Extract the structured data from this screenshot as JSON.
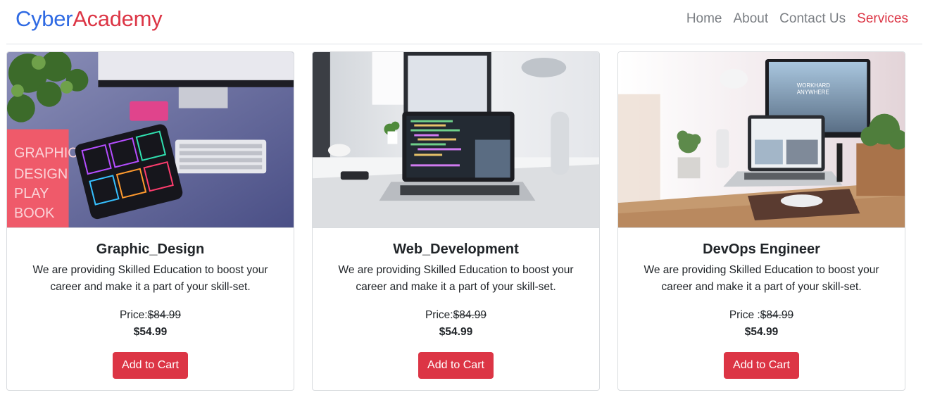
{
  "brand": {
    "part1": "Cyber",
    "part2": "Academy"
  },
  "nav": {
    "items": [
      {
        "label": "Home"
      },
      {
        "label": "About"
      },
      {
        "label": "Contact Us"
      },
      {
        "label": "Services"
      }
    ],
    "active": "Services"
  },
  "colors": {
    "brand_blue": "#2f6ae3",
    "accent_red": "#dc3545",
    "nav_gray": "#7a7e83"
  },
  "cards": [
    {
      "title": "Graphic_Design",
      "description": "We are providing Skilled Education to boost your career and make it a part of your skill-set.",
      "price_label": "Price:",
      "old_price": "$84.99",
      "new_price": "$54.99",
      "button": "Add to Cart"
    },
    {
      "title": "Web_Development",
      "description": "We are providing Skilled Education to boost your career and make it a part of your skill-set.",
      "price_label": "Price:",
      "old_price": "$84.99",
      "new_price": "$54.99",
      "button": "Add to Cart"
    },
    {
      "title": "DevOps Engineer",
      "description": "We are providing Skilled Education to boost your career and make it a part of your skill-set.",
      "price_label": "Price :",
      "old_price": "$84.99",
      "new_price": "$54.99",
      "button": "Add to Cart"
    }
  ]
}
